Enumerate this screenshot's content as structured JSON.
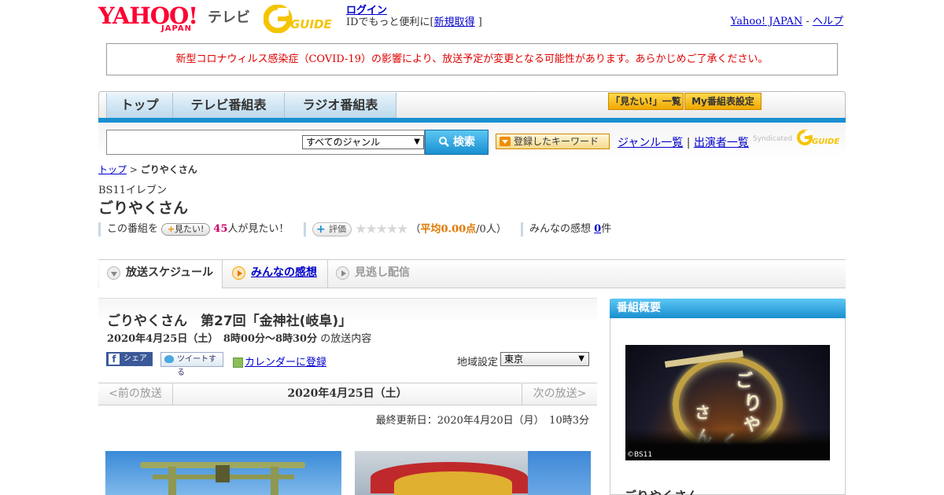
{
  "header": {
    "yahoo_wordmark": "YAHOO!",
    "yahoo_japan": "JAPAN",
    "tv_label": "テレビ",
    "guide_wordmark": "GUIDE",
    "login_link": "ログイン",
    "login_sub_prefix": "IDでもっと便利に[",
    "signup_link": "新規取得",
    "login_sub_suffix": "]",
    "yahoo_japan_link": "Yahoo! JAPAN",
    "link_separator": "-",
    "help_link": "ヘルプ"
  },
  "notice": {
    "text": "新型コロナウィルス感染症（COVID-19）の影響により、放送予定が変更となる可能性があります。あらかじめご了承ください。"
  },
  "nav": {
    "tabs": [
      {
        "label": "トップ"
      },
      {
        "label": "テレビ番組表"
      },
      {
        "label": "ラジオ番組表"
      }
    ],
    "mitai_list": "「見たい!」一覧",
    "my_program": "My番組表設定"
  },
  "search": {
    "input_value": "",
    "genre_selected": "すべてのジャンル",
    "search_button": "検索",
    "keyword_button": "登録したキーワード",
    "genre_list_link": "ジャンル一覧",
    "link_divider": "|",
    "performer_link": "出演者一覧",
    "syndicated_label": "Syndicated",
    "syndicated_guide": "GUIDE"
  },
  "breadcrumb": {
    "top": "トップ",
    "separator": ">",
    "current": "ごりやくさん"
  },
  "program": {
    "channel": "BS11イレブン",
    "title": "ごりやくさん",
    "mitai_prefix": "この番組を",
    "mitai_button": "見たい!",
    "mitai_count": "45",
    "mitai_suffix": "人が見たい！",
    "rating_button": "評価",
    "stars": "★★★★★",
    "rating_open": "（",
    "rating_avg": "平均0.00点",
    "rating_people": "/0人）",
    "review_prefix": "みんなの感想",
    "review_count": "0",
    "review_suffix": "件"
  },
  "tabs": [
    {
      "label": "放送スケジュール",
      "active": true
    },
    {
      "label": "みんなの感想",
      "active": false
    },
    {
      "label": "見逃し配信",
      "active": false
    }
  ],
  "episode": {
    "title": "ごりやくさん　第27回「金神社(岐阜)」",
    "datetime": "2020年4月25日（土）　8時00分～8時30分",
    "datetime_suffix": "の放送内容",
    "share_fb": "シェア",
    "share_tw": "ツイートする",
    "calendar_link": "カレンダーに登録",
    "region_label": "地域設定",
    "region_selected": "東京"
  },
  "datenav": {
    "prev": "<前の放送",
    "current": "2020年4月25日（土）",
    "next": "次の放送>"
  },
  "updated": "最終更新日：2020年4月20日（月）　10時3分",
  "sidebar": {
    "heading": "番組概要",
    "image_glyphs": [
      "ご",
      "り",
      "や",
      "く",
      "さ",
      "ん"
    ],
    "image_copyright": "©BS11",
    "program_name": "ごりやくさん"
  },
  "colors": {
    "yahoo_red": "#ff0033",
    "accent_blue": "#1a8fd0",
    "notice_red": "#e00000",
    "highlight_pink": "#cc0066",
    "rating_orange": "#e07800"
  }
}
